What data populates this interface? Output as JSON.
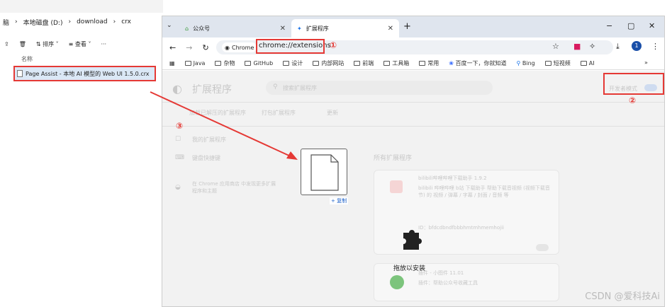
{
  "explorer": {
    "breadcrumb": [
      "脑",
      "本地磁盘 (D:)",
      "download",
      "crx"
    ],
    "toolbar": {
      "sort": "排序",
      "view": "查看",
      "more": "···"
    },
    "column_header": "名称",
    "file_name": "Page Assist - 本地 AI 模型的 Web UI 1.5.0.crx"
  },
  "chrome": {
    "tabs": [
      {
        "label": "公众号"
      },
      {
        "label": "扩展程序"
      }
    ],
    "new_tab": "+",
    "window_controls": {
      "min": "−",
      "max": "▢",
      "close": "✕"
    },
    "chip_label": "Chrome",
    "url": "chrome://extensions",
    "bookmarks": [
      "Java",
      "杂物",
      "GitHub",
      "设计",
      "内部网站",
      "前端",
      "工具箱",
      "常用",
      "百度一下，你就知道",
      "Bing",
      "短视频",
      "AI"
    ],
    "bookmarks_more": "»",
    "page_title": "扩展程序",
    "search_placeholder": "搜索扩展程序",
    "dev_mode": "开发者模式",
    "buttons": [
      "加载已解压的扩展程序",
      "打包扩展程序",
      "更新"
    ],
    "sidebar": [
      "我的扩展程序",
      "键盘快捷键"
    ],
    "sidebar_store": "在 Chrome 应用商店 中发现更多扩展程序和主题",
    "all_ext_title": "所有扩展程序",
    "ext1_name": "bilibili哔哩哔哩下载助手  1.9.2",
    "ext1_desc": "bilibili 哔哩哔哩 b站 下载助手 帮助下载音视频 (视频下载音节) 的 视频 / 弹幕 / 字幕 / 封面 / 音频 等",
    "ext1_id": "ID：bfdcdbndfbbbhmtmhmemhojii",
    "ext2_name": "插件 - 小图件  11.01",
    "ext2_desc": "插件：帮助公众号收藏工具",
    "drop_copy": "+ 复制",
    "drop_hint": "拖放以安装",
    "watermark": "CSDN @爱科技Ai"
  },
  "annotations": [
    "①",
    "②",
    "③"
  ],
  "colors": {
    "annotation_red": "#e53935",
    "tab_bar": "#dfe5ee",
    "toggle_blue": "#8ab4f8"
  }
}
